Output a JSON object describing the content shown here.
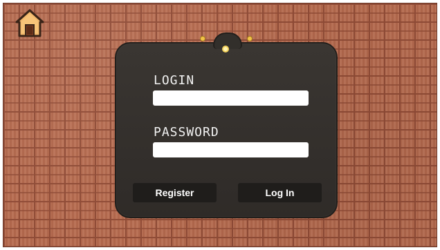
{
  "screen": {
    "background": "brick-wall"
  },
  "home": {
    "icon": "home-icon"
  },
  "login_panel": {
    "login_label": "LOGIN",
    "login_value": "",
    "password_label": "PASSWORD",
    "password_value": ""
  },
  "actions": {
    "register_label": "Register",
    "login_button_label": "Log In"
  },
  "colors": {
    "brick": "#b66a4e",
    "mortar": "#8f4b36",
    "panel": "#35312d",
    "button": "#1f1d1b",
    "accent": "#f3c347"
  }
}
